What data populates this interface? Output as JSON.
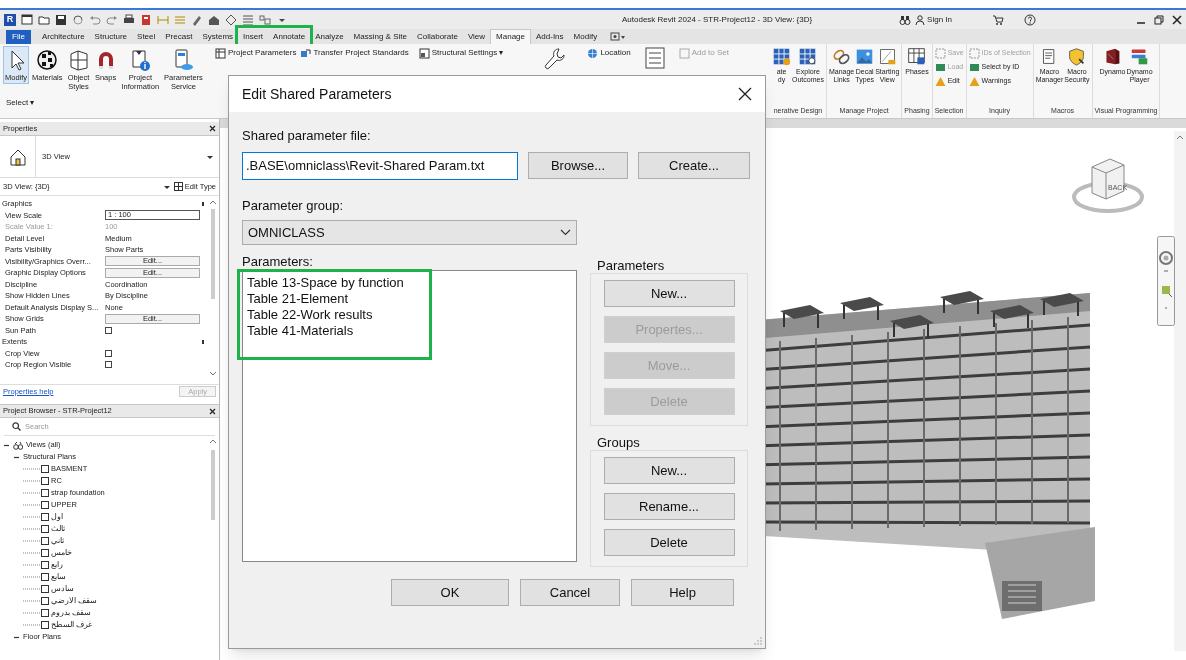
{
  "title_bar": {
    "app_logo": "R",
    "title": "Autodesk Revit 2024 - STR-Project12 - 3D View: {3D}",
    "sign_in": "Sign In"
  },
  "ribbon_tabs": [
    {
      "label": "File",
      "kind": "file",
      "selected": false,
      "highlighted": false
    },
    {
      "label": "Architecture",
      "kind": "tab",
      "selected": false,
      "highlighted": false
    },
    {
      "label": "Structure",
      "kind": "tab",
      "selected": false,
      "highlighted": false
    },
    {
      "label": "Steel",
      "kind": "tab",
      "selected": false,
      "highlighted": false
    },
    {
      "label": "Precast",
      "kind": "tab",
      "selected": false,
      "highlighted": false
    },
    {
      "label": "Systems",
      "kind": "tab",
      "selected": false,
      "highlighted": false
    },
    {
      "label": "Insert",
      "kind": "tab",
      "selected": false,
      "highlighted": true
    },
    {
      "label": "Annotate",
      "kind": "tab",
      "selected": false,
      "highlighted": true
    },
    {
      "label": "Analyze",
      "kind": "tab",
      "selected": false,
      "highlighted": false
    },
    {
      "label": "Massing & Site",
      "kind": "tab",
      "selected": false,
      "highlighted": false
    },
    {
      "label": "Collaborate",
      "kind": "tab",
      "selected": false,
      "highlighted": false
    },
    {
      "label": "View",
      "kind": "tab",
      "selected": false,
      "highlighted": false
    },
    {
      "label": "Manage",
      "kind": "tab",
      "selected": true,
      "highlighted": false
    },
    {
      "label": "Add-Ins",
      "kind": "tab",
      "selected": false,
      "highlighted": false
    },
    {
      "label": "Modify",
      "kind": "tab",
      "selected": false,
      "highlighted": false
    }
  ],
  "ribbon": {
    "large_tools": [
      {
        "label": "Modify",
        "selected": true
      },
      {
        "label": "Materials",
        "selected": false
      },
      {
        "label": "Object\nStyles",
        "selected": false
      },
      {
        "label": "Snaps",
        "selected": false
      },
      {
        "label": "Project\nInformation",
        "selected": false
      },
      {
        "label": "Parameters\nService",
        "selected": false
      }
    ],
    "select_panel": "Select ▾",
    "small_tools": [
      {
        "label": "Project Parameters",
        "disabled": false
      },
      {
        "label": "Transfer Project Standards",
        "disabled": false
      },
      {
        "label": "Structural Settings ▾",
        "disabled": false
      },
      {
        "label": "Location",
        "disabled": false
      },
      {
        "label": "Add to Set",
        "disabled": true
      }
    ],
    "panels": [
      {
        "label": "nerative Design",
        "tools": [
          {
            "label": "ate\ndy",
            "kind": "large",
            "disabled": false
          },
          {
            "label": "Explore\nOutcomes",
            "kind": "large",
            "disabled": false
          }
        ]
      },
      {
        "label": "Manage Project",
        "tools": [
          {
            "label": "Manage\nLinks",
            "kind": "large",
            "disabled": false
          },
          {
            "label": "Decal\nTypes",
            "kind": "large",
            "disabled": false
          },
          {
            "label": "Starting\nView",
            "kind": "large",
            "disabled": false
          }
        ]
      },
      {
        "label": "Phasing",
        "tools": [
          {
            "label": "Phases",
            "kind": "large",
            "disabled": false
          }
        ]
      },
      {
        "label": "Selection",
        "tools": [
          {
            "label": "Save",
            "kind": "small",
            "disabled": true
          },
          {
            "label": "Load",
            "kind": "small",
            "disabled": true
          },
          {
            "label": "Edit",
            "kind": "small",
            "disabled": false
          }
        ]
      },
      {
        "label": "Inquiry",
        "tools": [
          {
            "label": "IDs of Selection",
            "kind": "small",
            "disabled": true
          },
          {
            "label": "Select by ID",
            "kind": "small",
            "disabled": false
          },
          {
            "label": "Warnings",
            "kind": "small",
            "disabled": false
          }
        ]
      },
      {
        "label": "Macros",
        "tools": [
          {
            "label": "Macro\nManager",
            "kind": "large",
            "disabled": false
          },
          {
            "label": "Macro\nSecurity",
            "kind": "large",
            "disabled": false
          }
        ]
      },
      {
        "label": "Visual Programming",
        "tools": [
          {
            "label": "Dynamo",
            "kind": "large",
            "disabled": false
          },
          {
            "label": "Dynamo\nPlayer",
            "kind": "large",
            "disabled": false
          }
        ]
      }
    ]
  },
  "properties": {
    "title": "Properties",
    "type_name": "3D View",
    "instance": "3D View: {3D}",
    "edit_type": "Edit Type",
    "rows": [
      {
        "kind": "section",
        "label": "Graphics"
      },
      {
        "kind": "field",
        "label": "View Scale",
        "value": "1 : 100"
      },
      {
        "kind": "dim",
        "label": "Scale Value    1:",
        "value": "100"
      },
      {
        "kind": "text",
        "label": "Detail Level",
        "value": "Medium"
      },
      {
        "kind": "text",
        "label": "Parts Visibility",
        "value": "Show Parts"
      },
      {
        "kind": "button",
        "label": "Visibility/Graphics Overr...",
        "value": "Edit..."
      },
      {
        "kind": "button",
        "label": "Graphic Display Options",
        "value": "Edit..."
      },
      {
        "kind": "text",
        "label": "Discipline",
        "value": "Coordination"
      },
      {
        "kind": "text",
        "label": "Show Hidden Lines",
        "value": "By Discipline"
      },
      {
        "kind": "text",
        "label": "Default Analysis Display S...",
        "value": "None"
      },
      {
        "kind": "button",
        "label": "Show Grids",
        "value": "Edit..."
      },
      {
        "kind": "checkbox",
        "label": "Sun Path",
        "checked": false
      },
      {
        "kind": "section",
        "label": "Extents"
      },
      {
        "kind": "checkbox",
        "label": "Crop View",
        "checked": false
      },
      {
        "kind": "checkbox",
        "label": "Crop Region Visible",
        "checked": false
      }
    ],
    "help_link": "Properties help",
    "apply": "Apply"
  },
  "project_browser": {
    "title": "Project Browser - STR-Project12",
    "search_placeholder": "Search",
    "tree": [
      {
        "label": "Views (all)",
        "expanded": true,
        "children": [
          {
            "label": "Structural Plans",
            "expanded": true,
            "children": [
              {
                "label": "BASMENT"
              },
              {
                "label": "RC"
              },
              {
                "label": "strap foundation"
              },
              {
                "label": "UPPER"
              },
              {
                "label": "اول"
              },
              {
                "label": "ثالث"
              },
              {
                "label": "ثاني"
              },
              {
                "label": "خامس"
              },
              {
                "label": "رابع"
              },
              {
                "label": "سابع"
              },
              {
                "label": "سادس"
              },
              {
                "label": "سقف الارضي"
              },
              {
                "label": "سقف بدروم"
              },
              {
                "label": "غرف السطح"
              }
            ]
          },
          {
            "label": "Floor Plans",
            "expanded": true
          }
        ]
      }
    ]
  },
  "view_cube": {
    "face": "BACK"
  },
  "dialog": {
    "title": "Edit Shared Parameters",
    "file_label": "Shared parameter file:",
    "file_value": ".BASE\\omniclass\\Revit-Shared Param.txt",
    "browse": "Browse...",
    "create": "Create...",
    "group_label": "Parameter group:",
    "group_value": "OMNICLASS",
    "parameters_label": "Parameters:",
    "parameters": [
      {
        "label": "Table 13-Space by function",
        "selected": false,
        "highlighted": true
      },
      {
        "label": "Table 21-Element",
        "selected": false,
        "highlighted": true
      },
      {
        "label": "Table 22-Work results",
        "selected": false,
        "highlighted": true
      },
      {
        "label": "Table 41-Materials",
        "selected": false,
        "highlighted": true
      }
    ],
    "parameter_buttons_title": "Parameters",
    "parameter_buttons": [
      {
        "label": "New...",
        "disabled": false
      },
      {
        "label": "Propertes...",
        "disabled": true
      },
      {
        "label": "Move...",
        "disabled": true
      },
      {
        "label": "Delete",
        "disabled": true
      }
    ],
    "groups_title": "Groups",
    "group_buttons": [
      {
        "label": "New...",
        "disabled": false
      },
      {
        "label": "Rename...",
        "disabled": false
      },
      {
        "label": "Delete",
        "disabled": false
      }
    ],
    "footer_buttons": [
      "OK",
      "Cancel",
      "Help"
    ]
  }
}
